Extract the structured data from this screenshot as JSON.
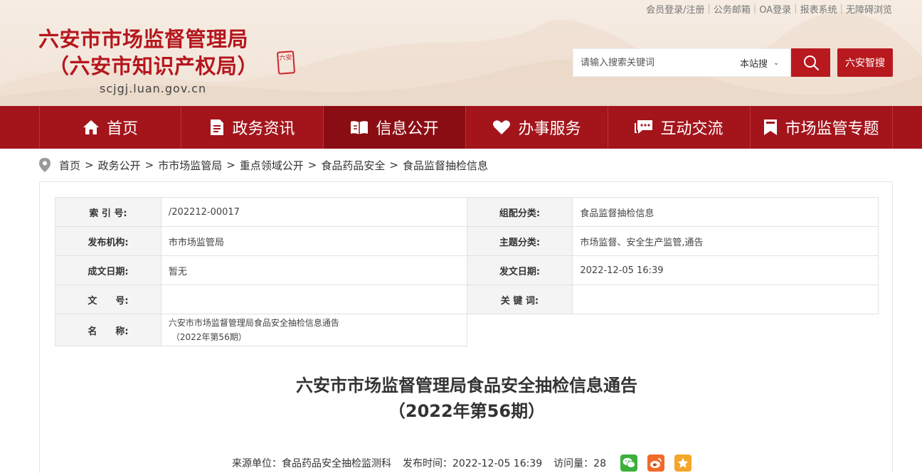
{
  "top_links": [
    "会员登录/注册",
    "公务邮箱",
    "OA登录",
    "报表系统",
    "无障碍浏览"
  ],
  "site": {
    "title_line1": "六安市市场监督管理局",
    "title_line2": "（六安市知识产权局）",
    "seal_text": "六安",
    "domain": "scjgj.luan.gov.cn"
  },
  "search": {
    "placeholder": "请输入搜索关键词",
    "scope": "本站搜",
    "brain_label": "六安智搜"
  },
  "nav": [
    {
      "label": "首页",
      "icon": "home-icon"
    },
    {
      "label": "政务资讯",
      "icon": "document-icon"
    },
    {
      "label": "信息公开",
      "icon": "open-book-icon"
    },
    {
      "label": "办事服务",
      "icon": "heart-icon"
    },
    {
      "label": "互动交流",
      "icon": "chat-icon"
    },
    {
      "label": "市场监管专题",
      "icon": "bookmark-icon"
    }
  ],
  "breadcrumb": [
    "首页",
    "政务公开",
    "市市场监管局",
    "重点领域公开",
    "食品药品安全",
    "食品监督抽检信息"
  ],
  "meta": {
    "index_key": "索 引 号:",
    "index_val": "/202212-00017",
    "category_key": "组配分类:",
    "category_val": "食品监督抽检信息",
    "org_key": "发布机构:",
    "org_val": "市市场监管局",
    "topic_key": "主题分类:",
    "topic_val": "市场监督、安全生产监管,通告",
    "created_key": "成文日期:",
    "created_val": "暂无",
    "published_key": "发文日期:",
    "published_val": "2022-12-05 16:39",
    "docno_key": "文　　号:",
    "docno_val": "",
    "keywords_key": "关 键 词:",
    "keywords_val": "",
    "name_key": "名　　称:",
    "name_val_line1": "六安市市场监督管理局食品安全抽检信息通告",
    "name_val_line2": "（2022年第56期）"
  },
  "article": {
    "title_line1": "六安市市场监督管理局食品安全抽检信息通告",
    "title_line2": "（2022年第56期）",
    "source": "来源单位：食品药品安全抽检监测科",
    "publish_time": "发布时间：2022-12-05 16:39",
    "views": "访问量：28"
  },
  "colors": {
    "brand_red": "#b5161d",
    "nav_bg": "#a3141b",
    "nav_active": "#8a0d13"
  }
}
